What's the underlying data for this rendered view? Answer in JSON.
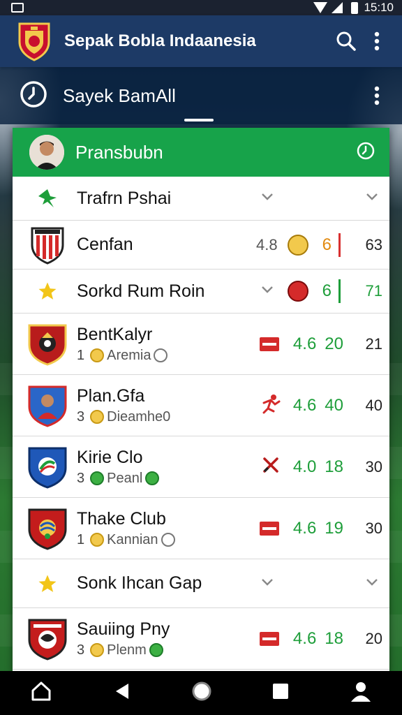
{
  "status_bar": {
    "time": "15:10"
  },
  "app_bar": {
    "title": "Sepak Bobla Indaanesia"
  },
  "sub_bar": {
    "title": "Sayek BamAll"
  },
  "card": {
    "title": "Pransbubn",
    "rows": [
      {
        "type": "filter",
        "name": "Trafrn Pshai"
      },
      {
        "type": "team",
        "name": "Cenfan",
        "rating": "4.8",
        "mid": "6",
        "last": "63"
      },
      {
        "type": "filter",
        "name": "Sorkd Rum Roin",
        "mid": "6",
        "last": "71"
      },
      {
        "type": "team",
        "name": "BentKalyr",
        "rank": "1",
        "sub": "Aremia",
        "rating": "4.6",
        "mid": "20",
        "last": "21"
      },
      {
        "type": "team",
        "name": "Plan.Gfa",
        "rank": "3",
        "sub": "Dieamhe0",
        "rating": "4.6",
        "mid": "40",
        "last": "40"
      },
      {
        "type": "team",
        "name": "Kirie Clo",
        "rank": "3",
        "sub": "Peanl",
        "rating": "4.0",
        "mid": "18",
        "last": "30"
      },
      {
        "type": "team",
        "name": "Thake Club",
        "rank": "1",
        "sub": "Kannian",
        "rating": "4.6",
        "mid": "19",
        "last": "30"
      },
      {
        "type": "filter",
        "name": "Sonk Ihcan Gap"
      },
      {
        "type": "team",
        "name": "Sauiing Pny",
        "rank": "3",
        "sub": "Plenm",
        "rating": "4.6",
        "mid": "18",
        "last": "20"
      }
    ]
  },
  "colors": {
    "header_green": "#17a34a",
    "app_bar": "#1d3a66",
    "accent_green": "#1e9e3a",
    "accent_red": "#d83030",
    "accent_orange": "#e28a10"
  },
  "icons": [
    "search-icon",
    "more-vert-icon",
    "clock-icon",
    "chevron-down-icon",
    "star-icon",
    "home-icon",
    "back-icon",
    "circle-home-icon",
    "square-recents-icon",
    "person-icon"
  ]
}
